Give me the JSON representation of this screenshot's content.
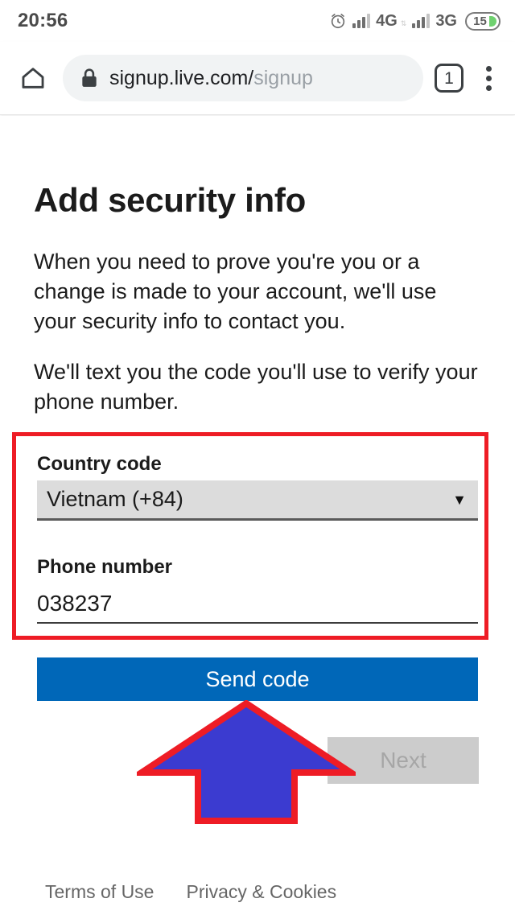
{
  "status_bar": {
    "clock": "20:56",
    "alarm_icon": "alarm-clock-icon",
    "sim1_network": "4G",
    "sim2_network": "3G",
    "data_arrows": "⇅",
    "battery_level": "15"
  },
  "browser": {
    "home_icon": "home-icon",
    "lock_icon": "lock-icon",
    "url_secure": "signup.live.com/",
    "url_path": "signup",
    "tab_count": "1",
    "menu_icon": "overflow-menu-icon"
  },
  "page": {
    "title": "Add security info",
    "intro_paragraph": "When you need to prove you're you or a change is made to your account, we'll use your security info to contact you.",
    "verify_paragraph": "We'll text you the code you'll use to verify your phone number.",
    "country_code": {
      "label": "Country code",
      "value": "Vietnam (+84)",
      "caret": "▼"
    },
    "phone_number": {
      "label": "Phone number",
      "value": "038237",
      "placeholder": ""
    },
    "send_code_button": "Send code",
    "next_button": "Next",
    "footer": {
      "terms": "Terms of Use",
      "privacy": "Privacy & Cookies"
    }
  },
  "annotation": {
    "arrow_icon": "up-arrow-annotation",
    "arrow_fill": "#3b3bd0",
    "arrow_stroke": "#ee1c25",
    "highlight_box_color": "#ee1c25"
  },
  "colors": {
    "primary_button": "#0067b8",
    "disabled_button": "#cccccc",
    "battery_fill": "#6fd16f"
  }
}
